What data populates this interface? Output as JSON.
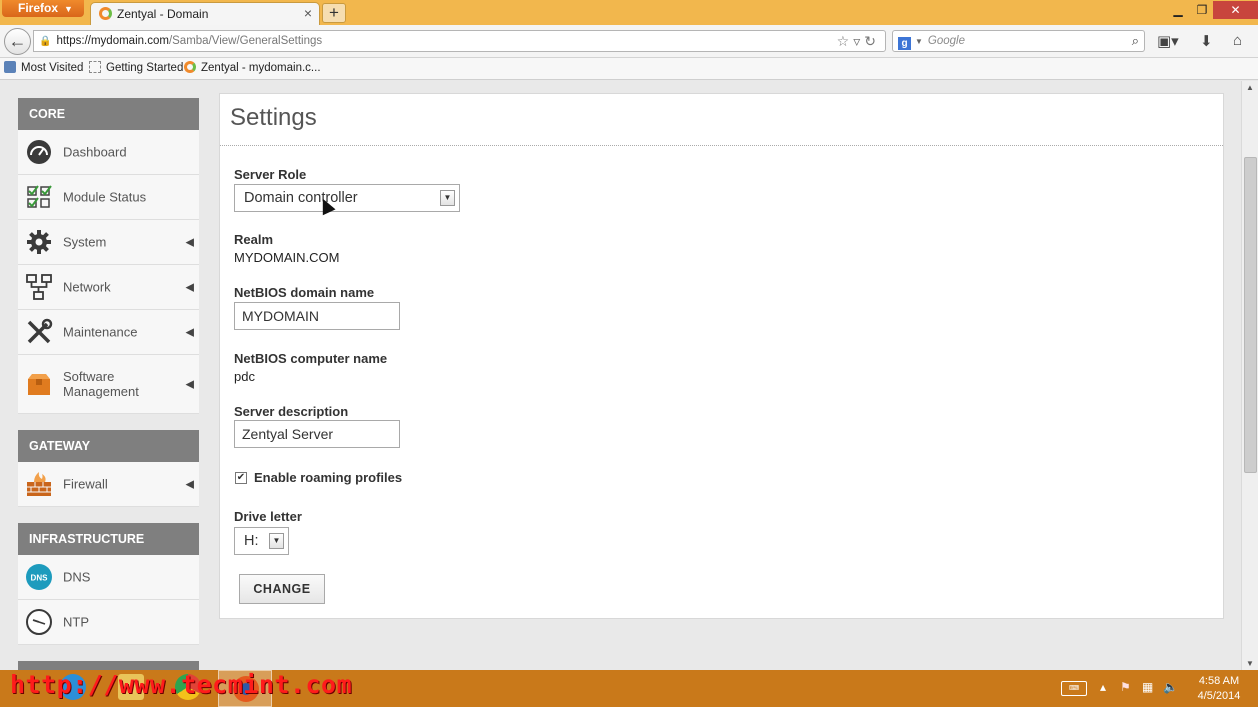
{
  "browser": {
    "firefox_button": "Firefox",
    "tab_title": "Zentyal - Domain",
    "new_tab": "+",
    "url_host": "https://mydomain.com",
    "url_path": "/Samba/View/GeneralSettings",
    "search_engine": "g",
    "search_placeholder": "Google",
    "bookmarks": [
      "Most Visited",
      "Getting Started",
      "Zentyal - mydomain.c..."
    ]
  },
  "sidebar": {
    "sections": [
      {
        "header": "CORE",
        "items": [
          "Dashboard",
          "Module Status",
          "System",
          "Network",
          "Maintenance",
          "Software Management"
        ]
      },
      {
        "header": "GATEWAY",
        "items": [
          "Firewall"
        ]
      },
      {
        "header": "INFRASTRUCTURE",
        "items": [
          "DNS",
          "NTP"
        ]
      }
    ]
  },
  "settings": {
    "title": "Settings",
    "server_role_label": "Server Role",
    "server_role_value": "Domain controller",
    "realm_label": "Realm",
    "realm_value": "MYDOMAIN.COM",
    "netbios_domain_label": "NetBIOS domain name",
    "netbios_domain_value": "MYDOMAIN",
    "netbios_computer_label": "NetBIOS computer name",
    "netbios_computer_value": "pdc",
    "server_description_label": "Server description",
    "server_description_value": "Zentyal Server",
    "roaming_label": "Enable roaming profiles",
    "roaming_checked": true,
    "drive_letter_label": "Drive letter",
    "drive_letter_value": "H:",
    "change_button": "CHANGE"
  },
  "taskbar": {
    "watermark": "http://www.tecmint.com",
    "time": "4:58 AM",
    "date": "4/5/2014"
  },
  "icons": {
    "dashboard": "gauge-icon",
    "module_status": "checklist-icon",
    "system": "gear-icon",
    "network": "network-icon",
    "maintenance": "tools-icon",
    "software": "box-icon",
    "firewall": "firewall-icon",
    "dns": "dns-icon",
    "ntp": "clock-icon"
  },
  "colors": {
    "titlebar": "#f2b74d",
    "sidebar_header": "#7f7f7f",
    "taskbar": "#c9791a",
    "watermark": "#ff1b1b"
  }
}
